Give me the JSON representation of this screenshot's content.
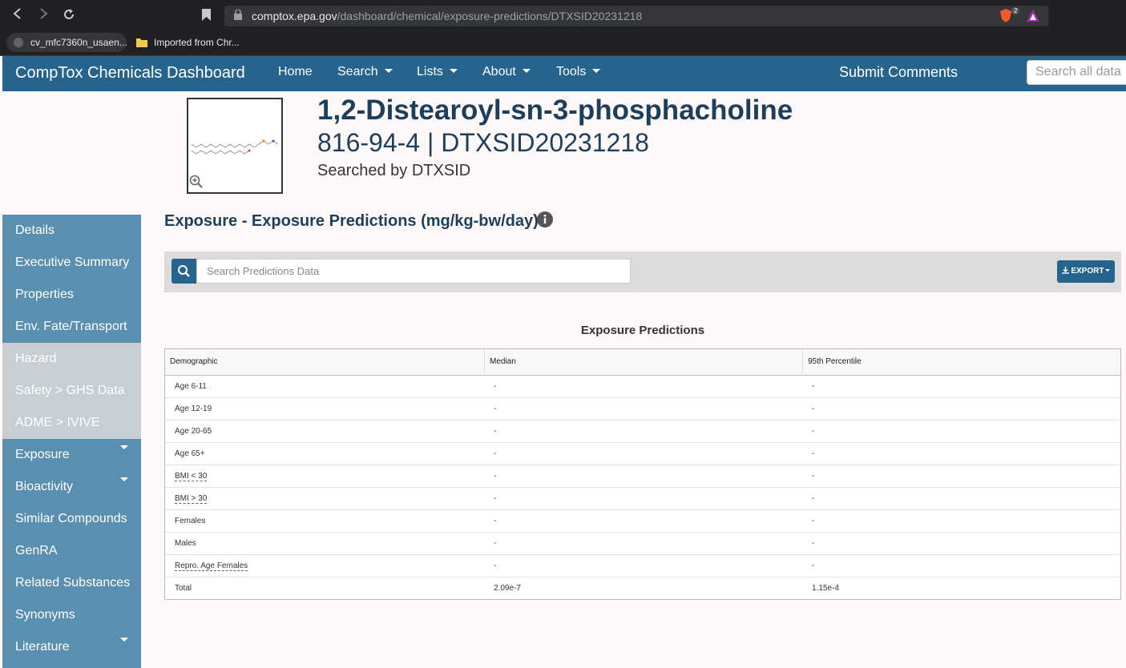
{
  "browser": {
    "url_host": "comptox.epa.gov",
    "url_path": "/dashboard/chemical/exposure-predictions/DTXSID20231218",
    "extension_badge": "2",
    "bookmarks": [
      "cv_mfc7360n_usaen...",
      "Imported from Chr..."
    ]
  },
  "navbar": {
    "brand": "CompTox Chemicals Dashboard",
    "items": [
      "Home",
      "Search",
      "Lists",
      "About",
      "Tools"
    ],
    "submit_comments": "Submit Comments",
    "search_placeholder": "Search all data"
  },
  "chemical": {
    "name": "1,2-Distearoyl-sn-3-phosphacholine",
    "ids": "816-94-4 | DTXSID20231218",
    "searched_by": "Searched by DTXSID"
  },
  "sidebar": {
    "items": [
      {
        "label": "Details"
      },
      {
        "label": "Executive Summary"
      },
      {
        "label": "Properties"
      },
      {
        "label": "Env. Fate/Transport"
      },
      {
        "label": "Hazard"
      },
      {
        "label": "Safety > GHS Data"
      },
      {
        "label": "ADME > IVIVE"
      },
      {
        "label": "Exposure"
      },
      {
        "label": "Bioactivity"
      },
      {
        "label": "Similar Compounds"
      },
      {
        "label": "GenRA"
      },
      {
        "label": "Related Substances"
      },
      {
        "label": "Synonyms"
      },
      {
        "label": "Literature"
      }
    ]
  },
  "main": {
    "section_title": "Exposure - Exposure Predictions (mg/kg-bw/day)",
    "search_placeholder": "Search Predictions Data",
    "export_label": "EXPORT",
    "table_title": "Exposure Predictions",
    "columns": [
      "Demographic",
      "Median",
      "95th Percentile"
    ],
    "rows": [
      [
        "Age 6-11",
        "-",
        "-"
      ],
      [
        "Age 12-19",
        "-",
        "-"
      ],
      [
        "Age 20-65",
        "-",
        "-"
      ],
      [
        "Age 65+",
        "-",
        "-"
      ],
      [
        "BMI < 30",
        "-",
        "-"
      ],
      [
        "BMI > 30",
        "-",
        "-"
      ],
      [
        "Females",
        "-",
        "-"
      ],
      [
        "Males",
        "-",
        "-"
      ],
      [
        "Repro. Age Females",
        "-",
        "-"
      ],
      [
        "Total",
        "2.09e-7",
        "1.15e-4"
      ]
    ]
  }
}
